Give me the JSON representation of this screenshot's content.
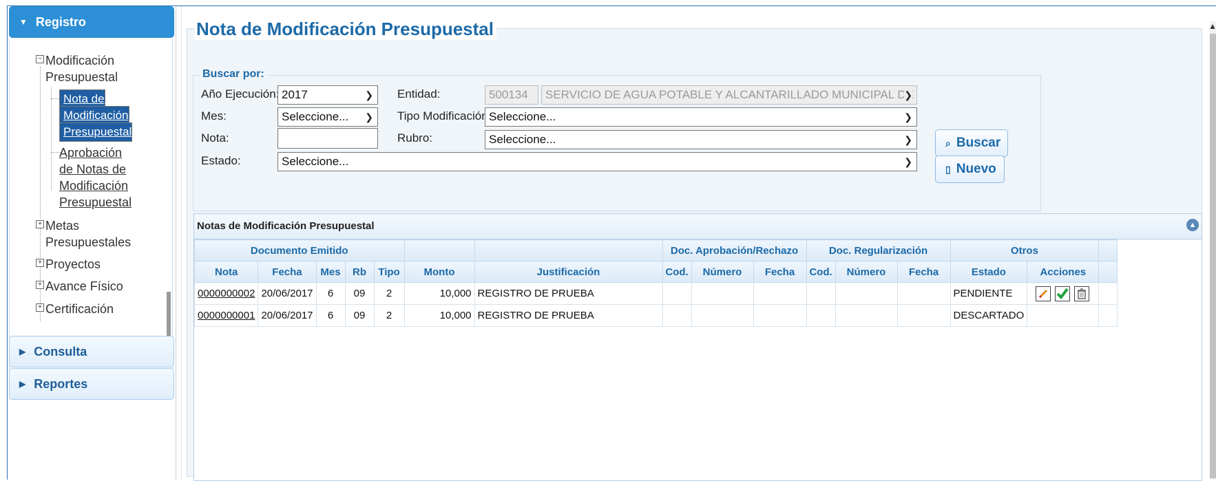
{
  "sidebar": {
    "sections": [
      {
        "label": "Registro"
      },
      {
        "label": "Consulta"
      },
      {
        "label": "Reportes"
      }
    ],
    "tree": {
      "modificacion_l1": "Modificación",
      "modificacion_l2": "Presupuestal",
      "nota_l1": "Nota de",
      "nota_l2": "Modificación",
      "nota_l3": "Presupuestal",
      "aprob_l1": "Aprobación",
      "aprob_l2": "de Notas de",
      "aprob_l3": "Modificación",
      "aprob_l4": "Presupuestal",
      "metas_l1": "Metas",
      "metas_l2": "Presupuestales",
      "proyectos": "Proyectos",
      "avance": "Avance Físico",
      "certificacion": "Certificación"
    }
  },
  "page": {
    "title": "Nota de Modificación Presupuestal"
  },
  "search": {
    "legend": "Buscar por:",
    "anio_label": "Año Ejecución:",
    "anio_value": "2017",
    "entidad_label": "Entidad:",
    "entidad_code": "500134",
    "entidad_name": "SERVICIO DE AGUA POTABLE Y ALCANTARILLADO MUNICIPAL DE HUANC",
    "mes_label": "Mes:",
    "mes_value": "Seleccione...",
    "tipo_label": "Tipo Modificación:",
    "tipo_value": "Seleccione...",
    "nota_label": "Nota:",
    "nota_value": "",
    "rubro_label": "Rubro:",
    "rubro_value": "Seleccione...",
    "estado_label": "Estado:",
    "estado_value": "Seleccione...",
    "buscar_label": "Buscar",
    "nuevo_label": "Nuevo"
  },
  "grid": {
    "caption": "Notas de Modificación Presupuestal",
    "groups": {
      "documento": "Documento Emitido",
      "aprobacion": "Doc. Aprobación/Rechazo",
      "regularizacion": "Doc. Regularización",
      "otros": "Otros"
    },
    "columns": {
      "nota": "Nota",
      "fecha": "Fecha",
      "mes": "Mes",
      "rb": "Rb",
      "tipo": "Tipo",
      "monto": "Monto",
      "justificacion": "Justificación",
      "a_cod": "Cod.",
      "a_numero": "Número",
      "a_fecha": "Fecha",
      "r_cod": "Cod.",
      "r_numero": "Número",
      "r_fecha": "Fecha",
      "estado": "Estado",
      "acciones": "Acciones"
    },
    "rows": [
      {
        "nota": "0000000002",
        "fecha": "20/06/2017",
        "mes": "6",
        "rb": "09",
        "tipo": "2",
        "monto": "10,000",
        "justificacion": "REGISTRO DE PRUEBA",
        "estado": "PENDIENTE",
        "actions": [
          "edit-icon",
          "approve-check-icon",
          "delete-trash-icon"
        ]
      },
      {
        "nota": "0000000001",
        "fecha": "20/06/2017",
        "mes": "6",
        "rb": "09",
        "tipo": "2",
        "monto": "10,000",
        "justificacion": "REGISTRO DE PRUEBA",
        "estado": "DESCARTADO",
        "actions": []
      }
    ]
  },
  "colors": {
    "accent": "#2d8fd6",
    "title": "#1c6aa8",
    "selected": "#1f5ea3",
    "approve": "#22a03a"
  }
}
